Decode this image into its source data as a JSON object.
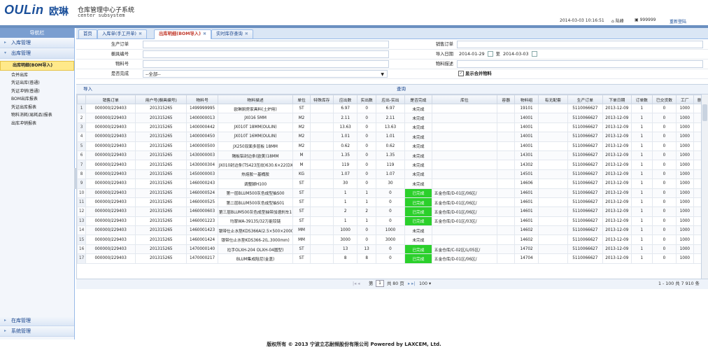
{
  "header": {
    "logo_text": "OULin",
    "logo_cn": "欧琳",
    "system_title": "仓库管理中心子系统",
    "system_subtitle": "center subsystem",
    "datetime": "2014-03-03 10:16:51",
    "home_label": "陆峰",
    "user_id": "999999",
    "relogin": "重新登陆"
  },
  "sidebar": {
    "title": "导航栏",
    "panels": [
      {
        "label": "入库管理"
      },
      {
        "label": "出库管理"
      }
    ],
    "items": [
      {
        "label": "出库明细(BOM导入)"
      },
      {
        "label": "合并出库"
      },
      {
        "label": "凭证出库(普通)"
      },
      {
        "label": "凭证冲销(普通)"
      },
      {
        "label": "BOM出库报表"
      },
      {
        "label": "凭证出库报表"
      },
      {
        "label": "物料消耗(易耗品)报表"
      },
      {
        "label": "出库冲销报表"
      }
    ],
    "bottom_panels": [
      {
        "label": "在库管理"
      },
      {
        "label": "系统管理"
      }
    ]
  },
  "tabs": [
    {
      "label": "首页"
    },
    {
      "label": "入库单(手工开单)"
    },
    {
      "label": "出库明细(BOM导入)"
    },
    {
      "label": "实时库存查询"
    }
  ],
  "form": {
    "production_order_label": "生产订单",
    "sales_order_label": "销售订单",
    "cabinet_no_label": "橱具编号",
    "import_date_label": "导入日期",
    "date_from": "2014-01-29",
    "date_to_sep": "至",
    "date_to": "2014-03-03",
    "material_no_label": "物料号",
    "material_desc_label": "物料描述",
    "completed_label": "是否完成",
    "completed_value": "--全部--",
    "merge_label": "显示合并物料"
  },
  "buttons": {
    "import": "导入",
    "query": "查询"
  },
  "grid": {
    "columns": [
      "销售订单",
      "用户号(橱具编号)",
      "物料号",
      "物料描述",
      "单位",
      "特殊库存",
      "应出数",
      "实出数",
      "应出-实出",
      "是否完成",
      "库位",
      "容器",
      "物料组",
      "有无配套",
      "生产订单",
      "下单日期",
      "订单数",
      "已交货数",
      "工厂",
      "删除"
    ],
    "rows": [
      [
        "1",
        "000000/229403",
        "201315265",
        "1499999995",
        "欧琳厨房家具料(土炉用)",
        "ST",
        "",
        "6.97",
        "0",
        "6.97",
        "未完成",
        "",
        "",
        "19101",
        "",
        "5110066627",
        "2013-12-09",
        "1",
        "0",
        "1000",
        ""
      ],
      [
        "2",
        "000000/229403",
        "201315265",
        "1400000013",
        "JX016 5MM",
        "M2",
        "",
        "2.11",
        "0",
        "2.11",
        "未完成",
        "",
        "",
        "14001",
        "",
        "5110066627",
        "2013-12-09",
        "1",
        "0",
        "1000",
        ""
      ],
      [
        "3",
        "000000/229403",
        "201315265",
        "1400000442",
        "JX010T  18MM(OULIN)",
        "M2",
        "",
        "13.63",
        "0",
        "13.63",
        "未完成",
        "",
        "",
        "14001",
        "",
        "5110066627",
        "2013-12-09",
        "1",
        "0",
        "1000",
        ""
      ],
      [
        "4",
        "000000/229403",
        "201315265",
        "1400000450",
        "JX010T  16MM(OULIN)",
        "M2",
        "",
        "1.01",
        "0",
        "1.01",
        "未完成",
        "",
        "",
        "14001",
        "",
        "5110066627",
        "2013-12-09",
        "1",
        "0",
        "1000",
        ""
      ],
      [
        "5",
        "000000/229403",
        "201315265",
        "1400000500",
        "JX250双面多层板 18MM",
        "M2",
        "",
        "0.62",
        "0",
        "0.62",
        "未完成",
        "",
        "",
        "14001",
        "",
        "5110066627",
        "2013-12-09",
        "1",
        "0",
        "1000",
        ""
      ],
      [
        "6",
        "000000/229403",
        "201315265",
        "1430000003",
        "隔板铝封边条(欧美)18MM",
        "M",
        "",
        "1.35",
        "0",
        "1.35",
        "未完成",
        "",
        "",
        "14301",
        "",
        "5110066627",
        "2013-12-09",
        "1",
        "0",
        "1000",
        ""
      ],
      [
        "7",
        "000000/229403",
        "201315265",
        "1430000304",
        "JX010封边条(TS423压纹)630.6×22(DX",
        "M",
        "",
        "119",
        "0",
        "119",
        "未完成",
        "",
        "",
        "14302",
        "",
        "5110066627",
        "2013-12-09",
        "1",
        "0",
        "1000",
        ""
      ],
      [
        "8",
        "000000/229403",
        "201315265",
        "1450000003",
        "热熔胶一基桶胶",
        "KG",
        "",
        "1.07",
        "0",
        "1.07",
        "未完成",
        "",
        "",
        "14501",
        "",
        "5110066627",
        "2013-12-09",
        "1",
        "0",
        "1000",
        ""
      ],
      [
        "9",
        "000000/229403",
        "201315265",
        "1460000243",
        "调整脚H100",
        "ST",
        "",
        "30",
        "0",
        "30",
        "未完成",
        "",
        "",
        "14606",
        "",
        "5110066627",
        "2013-12-09",
        "1",
        "0",
        "1000",
        ""
      ],
      [
        "10",
        "000000/229403",
        "201315265",
        "1460000524",
        "第一层BLUM500灰色成型抽S00",
        "ST",
        "",
        "1",
        "1",
        "0",
        "已完成",
        "五金仓库/D-01区/06区/",
        "",
        "14601",
        "",
        "5110066627",
        "2013-12-09",
        "1",
        "0",
        "1000",
        ""
      ],
      [
        "11",
        "000000/229403",
        "201315265",
        "1460000525",
        "第二层BLUM500灰色成型抽S01",
        "ST",
        "",
        "1",
        "1",
        "0",
        "已完成",
        "五金仓库/D-01区/06区/",
        "",
        "14601",
        "",
        "5110066627",
        "2013-12-09",
        "1",
        "0",
        "1000",
        ""
      ],
      [
        "12",
        "000000/229403",
        "201315265",
        "1460000603",
        "第三层BLUM500灰色成型抽带加速刹车1",
        "ST",
        "",
        "2",
        "2",
        "0",
        "已完成",
        "五金仓库/D-01区/06区/",
        "",
        "14601",
        "",
        "5110066627",
        "2013-12-09",
        "1",
        "0",
        "1000",
        ""
      ],
      [
        "13",
        "000000/229403",
        "201315265",
        "1460001223",
        "均厚WA-39135/32万能铰链",
        "ST",
        "",
        "1",
        "1",
        "0",
        "已完成",
        "五金仓库/D-01区/03区/",
        "",
        "14601",
        "",
        "5110066627",
        "2013-12-09",
        "1",
        "0",
        "1000",
        ""
      ],
      [
        "14",
        "000000/229403",
        "201315265",
        "1460001423",
        "银带仕止水垫KDS366A(2.5×500×2000mm",
        "MM",
        "",
        "1000",
        "0",
        "1000",
        "未完成",
        "",
        "",
        "14602",
        "",
        "5110066627",
        "2013-12-09",
        "1",
        "0",
        "1000",
        ""
      ],
      [
        "15",
        "000000/229403",
        "201315265",
        "1460001424",
        "银带仕止水垫KDS366-2(L.3000mm)",
        "MM",
        "",
        "3000",
        "0",
        "3000",
        "未完成",
        "",
        "",
        "14602",
        "",
        "5110066627",
        "2013-12-09",
        "1",
        "0",
        "1000",
        ""
      ],
      [
        "16",
        "000000/229403",
        "201315265",
        "1470000140",
        "拉手OLXH-204 OLXH-04圆型)",
        "ST",
        "",
        "13",
        "13",
        "0",
        "已完成",
        "五金仓库/C-02区/L/05区/",
        "",
        "14702",
        "",
        "5110066627",
        "2013-12-09",
        "1",
        "0",
        "1000",
        ""
      ],
      [
        "17",
        "000000/229403",
        "201315265",
        "1470000217",
        "BLUM集成阻尼(金盖)",
        "ST",
        "",
        "8",
        "8",
        "0",
        "已完成",
        "五金仓库/D-01区/06区/",
        "",
        "14704",
        "",
        "5110066627",
        "2013-12-09",
        "1",
        "0",
        "1000",
        ""
      ]
    ]
  },
  "pager": {
    "page_label": "第",
    "page_value": "1",
    "total_pages": "共 80 页",
    "page_size": "100",
    "summary": "1 - 100  共 7 910 条"
  },
  "footer": {
    "copyright": "版权所有 © 2013 宁波立芯耐频股份有限公司 Powered by LAXCEM, Ltd."
  },
  "colors": {
    "accent": "#6a8fc0",
    "done": "#2bd02b"
  }
}
